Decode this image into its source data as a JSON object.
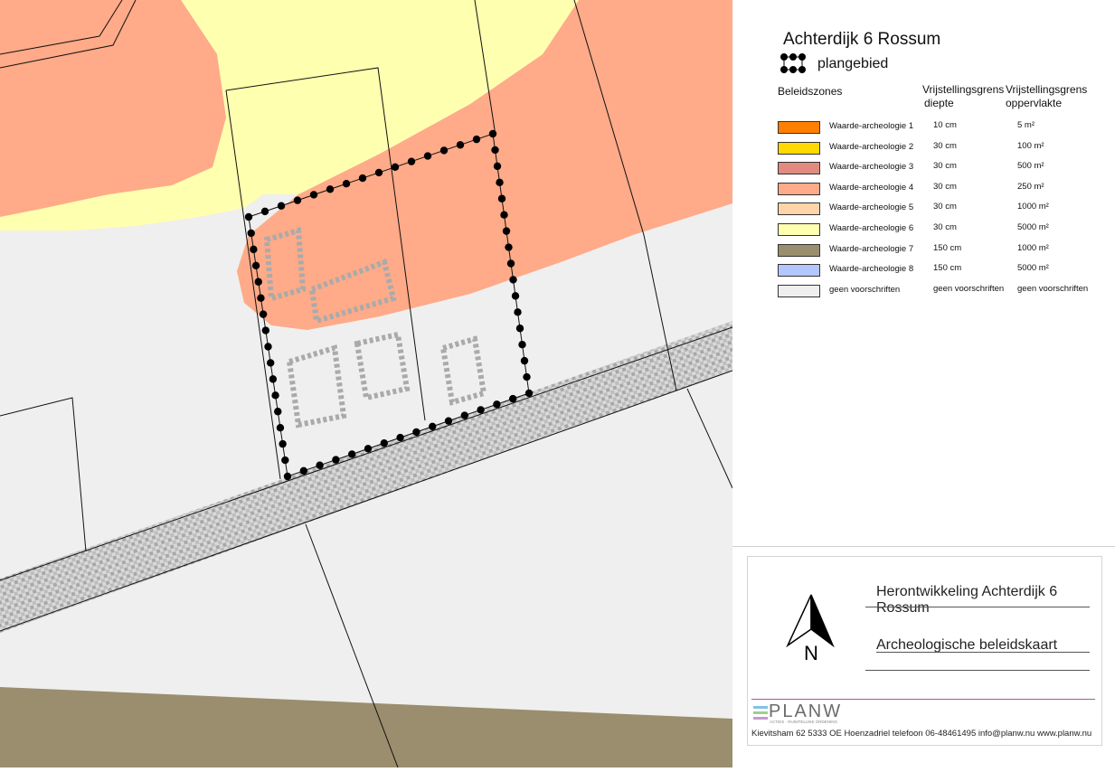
{
  "legend": {
    "title": "Achterdijk 6 Rossum",
    "plangebied_label": "plangebied",
    "column_zones": "Beleidszones",
    "column_depth": [
      "Vrijstellingsgrens",
      "diepte"
    ],
    "column_area": [
      "Vrijstellingsgrens",
      "oppervlakte"
    ],
    "items": [
      {
        "label": "Waarde-archeologie 1",
        "color": "#ff8000",
        "depth": "10 cm",
        "area": "5 m²"
      },
      {
        "label": "Waarde-archeologie 2",
        "color": "#ffd900",
        "depth": "30 cm",
        "area": "100 m²"
      },
      {
        "label": "Waarde-archeologie 3",
        "color": "#e08a80",
        "depth": "30 cm",
        "area": "500 m²"
      },
      {
        "label": "Waarde-archeologie 4",
        "color": "#ffaa88",
        "depth": "30 cm",
        "area": "250 m²"
      },
      {
        "label": "Waarde-archeologie 5",
        "color": "#ffd4a8",
        "depth": "30 cm",
        "area": "1000 m²"
      },
      {
        "label": "Waarde-archeologie 6",
        "color": "#ffffb0",
        "depth": "30 cm",
        "area": "5000 m²"
      },
      {
        "label": "Waarde-archeologie 7",
        "color": "#9a8e6e",
        "depth": "150 cm",
        "area": "1000 m²"
      },
      {
        "label": "Waarde-archeologie 8",
        "color": "#b4c6ff",
        "depth": "150 cm",
        "area": "5000 m²"
      },
      {
        "label": "geen voorschriften",
        "color": "#efefef",
        "depth": "geen voorschriften",
        "area": "geen voorschriften"
      }
    ]
  },
  "titleblock": {
    "project": "Herontwikkeling Achterdijk 6 Rossum",
    "map_title": "Archeologische beleidskaart",
    "north_label": "N",
    "logo_text": "PLANW",
    "logo_subtext": "ACTIES · RUIMTELIJKE ORDENING",
    "contact": "Kievitsham 62 5333 OE Hoenzadriel telefoon 06-48461495 info@planw.nu www.planw.nu"
  },
  "map": {
    "colors": {
      "zone4": "#ffaa88",
      "zone6": "#ffffb0",
      "zone7": "#9a8e6e",
      "none": "#efefef",
      "road_hatch": "#9a9a9a",
      "outline": "#111111"
    }
  }
}
